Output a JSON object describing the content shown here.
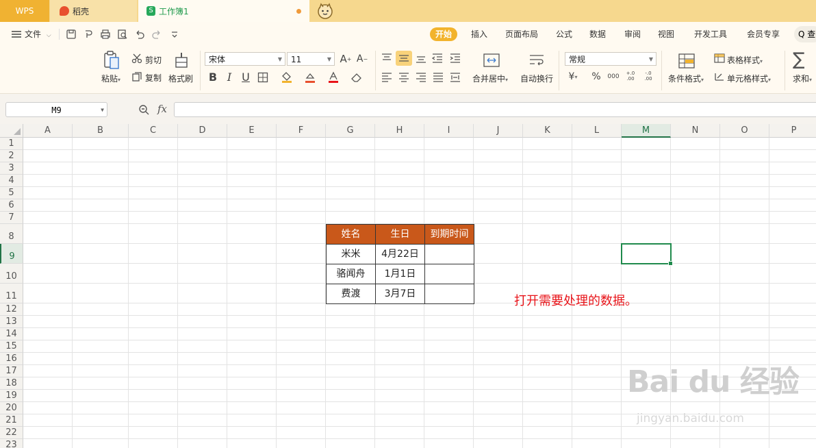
{
  "titlebar": {
    "tabs": [
      {
        "label": "WPS"
      },
      {
        "label": "稻壳"
      },
      {
        "label": "工作簿1"
      }
    ]
  },
  "menubar": {
    "file_label": "文件",
    "tabs": [
      "开始",
      "插入",
      "页面布局",
      "公式",
      "数据",
      "审阅",
      "视图",
      "开发工具",
      "会员专享"
    ],
    "active_tab": "开始",
    "search_label": "Q 查"
  },
  "ribbon": {
    "paste": "粘贴",
    "cut": "剪切",
    "copy": "复制",
    "format_painter": "格式刷",
    "font_name": "宋体",
    "font_size": "11",
    "merge_center": "合并居中",
    "wrap_text": "自动换行",
    "number_format": "常规",
    "conditional_format": "条件格式",
    "table_style": "表格样式",
    "cell_style": "单元格样式",
    "sum": "求和",
    "bold": "B",
    "italic": "I",
    "underline": "U",
    "currency": "¥",
    "percent": "%",
    "thousands": "000",
    "inc_decimal": "+.0 .00",
    "dec_decimal": "-.0 .00"
  },
  "formula_bar": {
    "name_box": "M9",
    "fx_label": "fx",
    "formula": ""
  },
  "grid": {
    "columns": [
      "A",
      "B",
      "C",
      "D",
      "E",
      "F",
      "G",
      "H",
      "I",
      "J",
      "K",
      "L",
      "M",
      "N",
      "O",
      "P"
    ],
    "rows": [
      "1",
      "2",
      "3",
      "4",
      "5",
      "6",
      "7",
      "8",
      "9",
      "10",
      "11",
      "12",
      "13",
      "14",
      "15",
      "16",
      "17",
      "18",
      "19",
      "20",
      "21",
      "22",
      "23"
    ],
    "selected_column": "M",
    "selected_row": "9"
  },
  "table": {
    "headers": [
      "姓名",
      "生日",
      "到期时间"
    ],
    "rows": [
      [
        "米米",
        "4月22日",
        ""
      ],
      [
        "骆闻舟",
        "1月1日",
        ""
      ],
      [
        "费渡",
        "3月7日",
        ""
      ]
    ],
    "header_color": "#c9581a"
  },
  "annotation": "打开需要处理的数据。",
  "watermark": {
    "main": "Bai du 经验",
    "sub": "jingyan.baidu.com"
  }
}
